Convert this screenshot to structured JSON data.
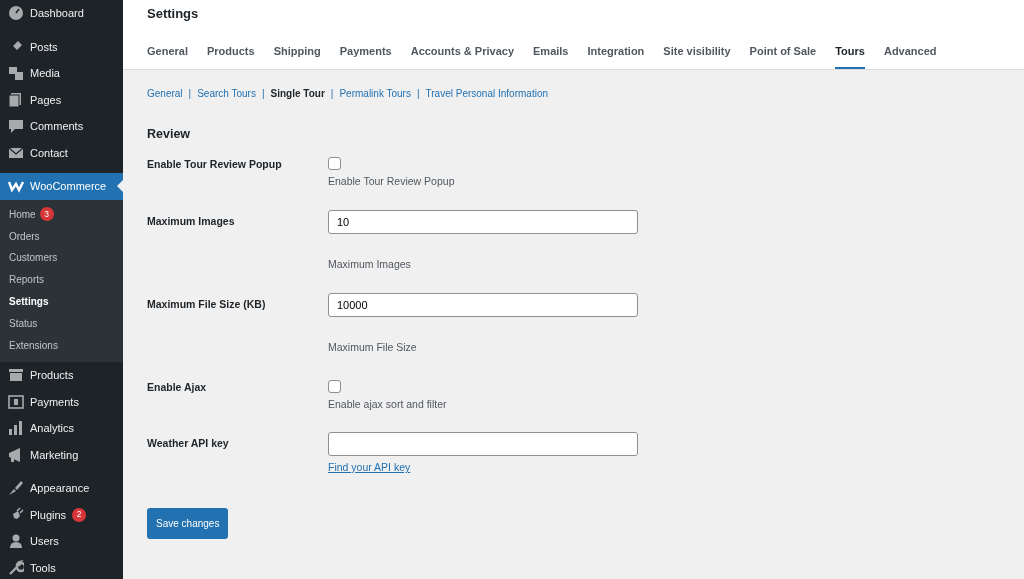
{
  "sidebar": {
    "groups": [
      [
        {
          "label": "Dashboard"
        }
      ],
      [
        {
          "label": "Posts"
        },
        {
          "label": "Media"
        },
        {
          "label": "Pages"
        },
        {
          "label": "Comments"
        },
        {
          "label": "Contact"
        }
      ],
      [
        {
          "label": "WooCommerce",
          "selected": true,
          "children": [
            {
              "label": "Home",
              "badge": "3",
              "selected": false
            },
            {
              "label": "Orders",
              "selected": false
            },
            {
              "label": "Customers",
              "selected": false
            },
            {
              "label": "Reports",
              "selected": false
            },
            {
              "label": "Settings",
              "selected": true
            },
            {
              "label": "Status",
              "selected": false
            },
            {
              "label": "Extensions",
              "selected": false
            }
          ]
        },
        {
          "label": "Products"
        },
        {
          "label": "Payments"
        },
        {
          "label": "Analytics"
        },
        {
          "label": "Marketing"
        }
      ],
      [
        {
          "label": "Appearance"
        },
        {
          "label": "Plugins",
          "badge": "2"
        },
        {
          "label": "Users"
        },
        {
          "label": "Tools"
        }
      ]
    ]
  },
  "page_title": "Settings",
  "tabs": [
    {
      "label": "General",
      "selected": false
    },
    {
      "label": "Products",
      "selected": false
    },
    {
      "label": "Shipping",
      "selected": false
    },
    {
      "label": "Payments",
      "selected": false
    },
    {
      "label": "Accounts & Privacy",
      "selected": false
    },
    {
      "label": "Emails",
      "selected": false
    },
    {
      "label": "Integration",
      "selected": false
    },
    {
      "label": "Site visibility",
      "selected": false
    },
    {
      "label": "Point of Sale",
      "selected": false
    },
    {
      "label": "Tours",
      "selected": true
    },
    {
      "label": "Advanced",
      "selected": false
    }
  ],
  "subtabs": [
    {
      "label": "General",
      "selected": false
    },
    {
      "label": "Search Tours",
      "selected": false
    },
    {
      "label": "Single Tour",
      "selected": true
    },
    {
      "label": "Permalink Tours",
      "selected": false
    },
    {
      "label": "Travel Personal Information",
      "selected": false
    }
  ],
  "subtab_separator": "|",
  "section_title": "Review",
  "fields": [
    {
      "kind": "checkbox",
      "label": "Enable Tour Review Popup",
      "checked": false,
      "description": "Enable Tour Review Popup"
    },
    {
      "kind": "text",
      "label": "Maximum Images",
      "value": "10",
      "description": "Maximum Images"
    },
    {
      "kind": "text",
      "label": "Maximum File Size (KB)",
      "value": "10000",
      "description": "Maximum File Size"
    },
    {
      "kind": "checkbox",
      "label": "Enable Ajax",
      "checked": false,
      "description": "Enable ajax sort and filter"
    },
    {
      "kind": "text",
      "label": "Weather API key",
      "link": "Find your API key"
    }
  ],
  "save_button": "Save changes"
}
